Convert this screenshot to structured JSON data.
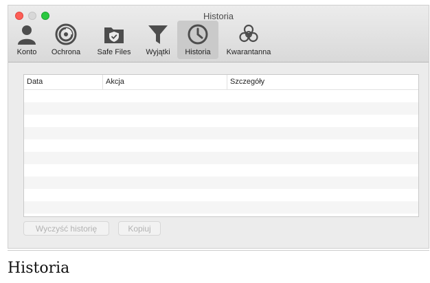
{
  "window": {
    "title": "Historia"
  },
  "toolbar": {
    "items": [
      {
        "label": "Konto",
        "icon": "user-icon"
      },
      {
        "label": "Ochrona",
        "icon": "protection-icon"
      },
      {
        "label": "Safe Files",
        "icon": "safe-files-icon"
      },
      {
        "label": "Wyjątki",
        "icon": "filter-icon"
      },
      {
        "label": "Historia",
        "icon": "clock-icon",
        "active": true
      },
      {
        "label": "Kwarantanna",
        "icon": "biohazard-icon"
      }
    ]
  },
  "table": {
    "columns": [
      "Data",
      "Akcja",
      "Szczegóły"
    ],
    "rows": []
  },
  "buttons": {
    "clear_history": "Wyczyść historię",
    "copy": "Kopiuj"
  },
  "caption": "Historia",
  "colors": {
    "close": "#fd5f57",
    "minimize": "#d8d8d8",
    "maximize": "#2ac83f",
    "active_tab": "#cacaca",
    "icon": "#4d4d4d"
  }
}
